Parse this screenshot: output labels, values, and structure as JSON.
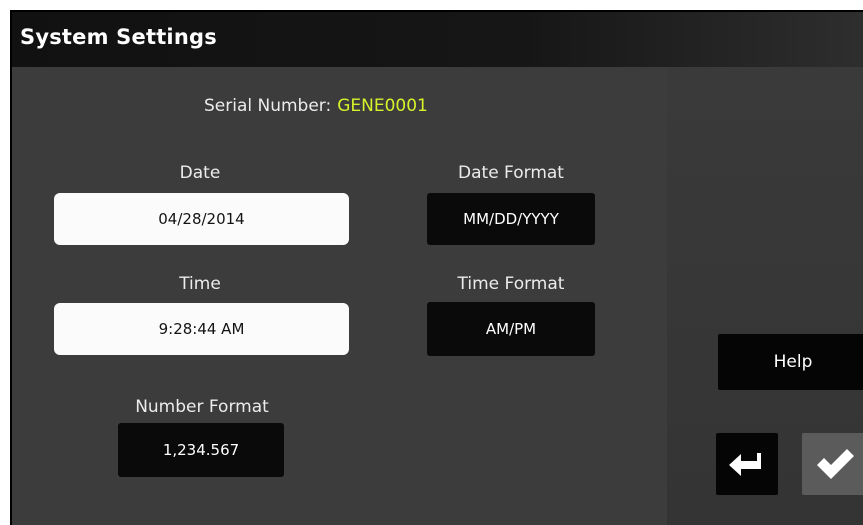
{
  "window": {
    "title": "System Settings"
  },
  "serial": {
    "label": "Serial Number:",
    "value": "GENE0001"
  },
  "date": {
    "label": "Date",
    "value": "04/28/2014"
  },
  "date_format": {
    "label": "Date Format",
    "value": "MM/DD/YYYY"
  },
  "time": {
    "label": "Time",
    "value": "9:28:44 AM"
  },
  "time_format": {
    "label": "Time Format",
    "value": "AM/PM"
  },
  "number_format": {
    "label": "Number Format",
    "value": "1,234.567"
  },
  "actions": {
    "help_label": "Help",
    "back_icon": "return-arrow-icon",
    "confirm_icon": "checkmark-icon"
  },
  "colors": {
    "background": "#3c3c3c",
    "titlebar": "#111111",
    "serial_value": "#d7f22a",
    "light_field": "#fbfbfb",
    "dark_field": "#0a0a0a"
  }
}
